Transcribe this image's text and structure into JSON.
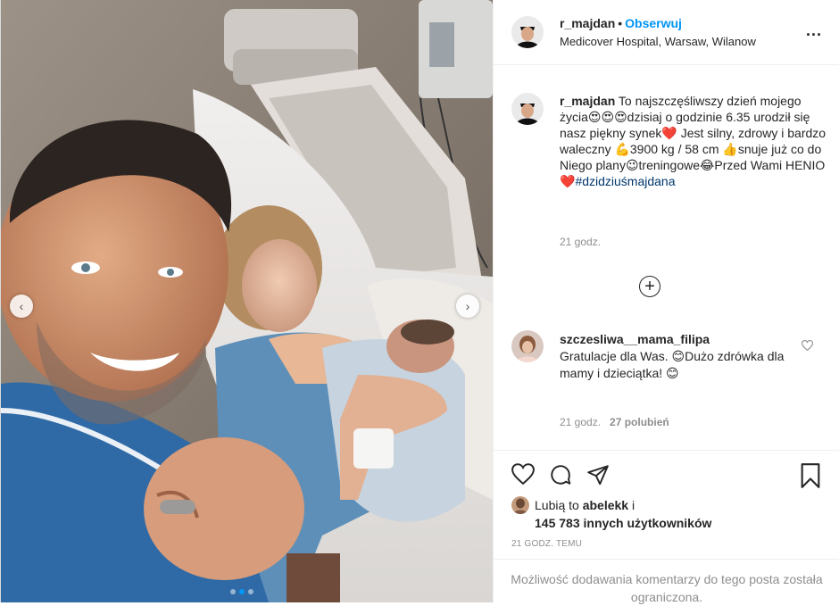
{
  "photo": {
    "prev_label": "‹",
    "next_label": "›",
    "carousel_count": 3,
    "active_index": 1
  },
  "header": {
    "username": "r_majdan",
    "separator": "•",
    "follow_label": "Obserwuj",
    "location": "Medicover Hospital, Warsaw, Wilanow",
    "more_label": "..."
  },
  "caption": {
    "username": "r_majdan",
    "text_1": "To najszczęśliwszy dzień mojego życia😍😍😍dzisiaj o godzinie 6.35 urodził się nasz piękny synek❤️ Jest silny, zdrowy i bardzo waleczny 💪3900 kg / 58 cm 👍snuje już co do Niego plany😉treningowe😂Przed Wami HENIO❤️",
    "hashtag": "#dzidziuśmajdana",
    "time": "21 godz."
  },
  "load_more": {
    "label": "+"
  },
  "comment": {
    "username": "szczesliwa__mama_filipa",
    "text": "Gratulacje dla Was. 😊Dużo zdrówka dla mamy i dzieciątka! 😊",
    "time": "21 godz.",
    "likes": "27 polubień"
  },
  "likes": {
    "prefix": "Lubią to",
    "liker": "abelekk",
    "conj": "i",
    "count_text": "145 783 innych użytkowników"
  },
  "timeago": "21 godz. temu",
  "restricted_text": "Możliwość dodawania komentarzy do tego posta została ograniczona.",
  "colors": {
    "accent": "#0095f6",
    "hashtag": "#00376b",
    "muted": "#8e8e8e"
  },
  "icons": [
    "heart-icon",
    "comment-icon",
    "share-icon",
    "bookmark-icon",
    "more-icon",
    "plus-icon"
  ]
}
